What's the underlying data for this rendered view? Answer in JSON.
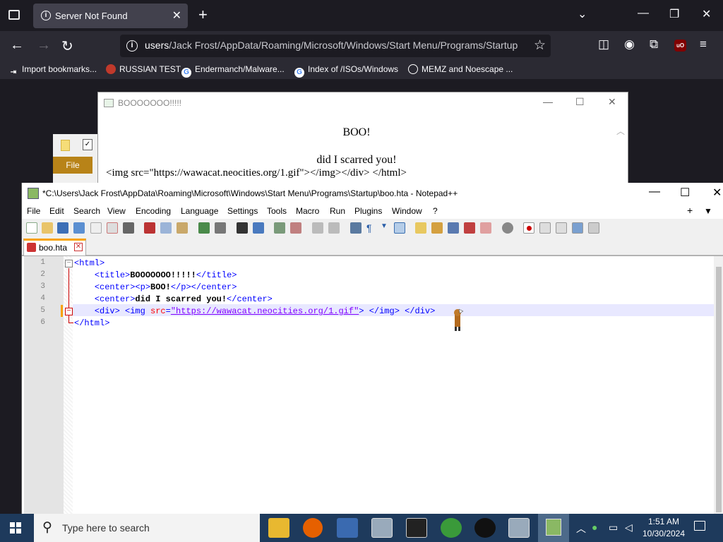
{
  "browser": {
    "tab_title": "Server Not Found",
    "url_prefix": "users",
    "url_rest": "/Jack Frost/AppData/Roaming/Microsoft/Windows/Start Menu/Programs/Startup",
    "bookmarks": [
      {
        "label": "Import bookmarks..."
      },
      {
        "label": "RUSSIAN TEST"
      },
      {
        "label": "Endermanch/Malware..."
      },
      {
        "label": "Index of /ISOs/Windows"
      },
      {
        "label": "MEMZ and Noescape ..."
      }
    ]
  },
  "hta": {
    "title": "BOOOOOOO!!!!!",
    "boo": "BOO!",
    "scarred": "did I scarred you!",
    "raw": "<img src=\"https://wawacat.neocities.org/1.gif\"></img></div> </html>"
  },
  "explorer": {
    "file_tab": "File"
  },
  "npp": {
    "title": "*C:\\Users\\Jack Frost\\AppData\\Roaming\\Microsoft\\Windows\\Start Menu\\Programs\\Startup\\boo.hta - Notepad++",
    "menu": [
      "File",
      "Edit",
      "Search",
      "View",
      "Encoding",
      "Language",
      "Settings",
      "Tools",
      "Macro",
      "Run",
      "Plugins",
      "Window",
      "?"
    ],
    "tab_name": "boo.hta",
    "line_numbers": [
      "1",
      "2",
      "3",
      "4",
      "5",
      "6"
    ],
    "code": {
      "l1_tag": "<html>",
      "l2_open": "<title>",
      "l2_text": "BOOOOOOO!!!!!",
      "l2_close": "</title>",
      "l3_open": "<center><p>",
      "l3_text": "BOO!",
      "l3_close": "</p></center>",
      "l4_open": "<center>",
      "l4_text": "did I scarred you!",
      "l4_close": "</center>",
      "l5_a": "<div> <img ",
      "l5_attr": "src",
      "l5_eq": "=",
      "l5_str": "\"https://wawacat.neocities.org/1.gif\"",
      "l5_b": "> </img> </div>",
      "l6_tag": "</html>"
    }
  },
  "taskbar": {
    "search_placeholder": "Type here to search",
    "time": "1:51 AM",
    "date": "10/30/2024"
  },
  "colors": {
    "taskbar": "#1e3a5c",
    "browser_bg": "#1c1b22",
    "npp_tab_accent": "#f8a200"
  }
}
